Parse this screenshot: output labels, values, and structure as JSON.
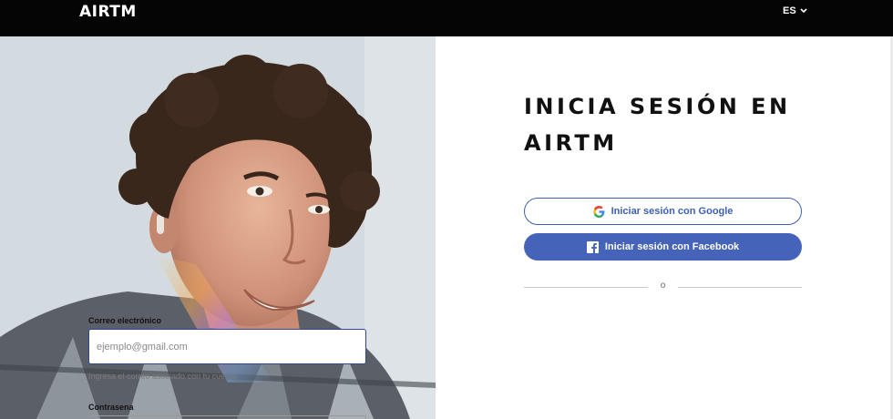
{
  "header": {
    "logo": "AIRTM",
    "language": "ES"
  },
  "hero": {
    "image": "smiling-young-man-photo"
  },
  "login": {
    "title": "INICIA SESIÓN EN AIRTM",
    "google_button": "Iniciar sesión con Google",
    "facebook_button": "Iniciar sesión con Facebook",
    "divider_text": "o",
    "email_label": "Correo electrónico",
    "email_placeholder": "ejemplo@gmail.com",
    "email_value": "",
    "email_hint": "Ingresa el correo asociado con tu cuenta",
    "password_label": "Contrasena"
  },
  "colors": {
    "topbar": "#050505",
    "brand_blue": "#3f5fb4",
    "facebook_blue": "#4463b9"
  }
}
